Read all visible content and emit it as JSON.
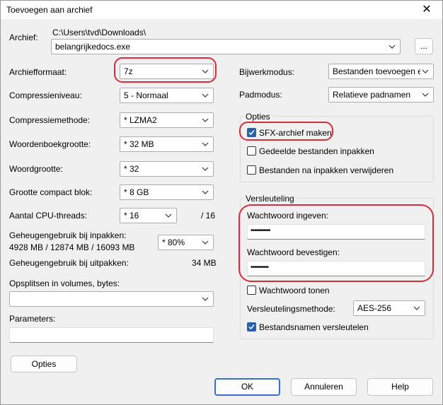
{
  "window": {
    "title": "Toevoegen aan archief",
    "close_glyph": "✕"
  },
  "archive": {
    "label": "Archief:",
    "path": "C:\\Users\\tvd\\Downloads\\",
    "filename": "belangrijkedocs.exe",
    "browse_label": "..."
  },
  "left": {
    "format": {
      "label": "Archiefformaat:",
      "value": "7z"
    },
    "level": {
      "label": "Compressieniveau:",
      "value": "5 - Normaal"
    },
    "method": {
      "label": "Compressiemethode:",
      "value": "*  LZMA2"
    },
    "dict": {
      "label": "Woordenboekgrootte:",
      "value": "*  32 MB"
    },
    "word": {
      "label": "Woordgrootte:",
      "value": "*  32"
    },
    "solid": {
      "label": "Grootte compact blok:",
      "value": "*  8 GB"
    },
    "threads": {
      "label": "Aantal CPU-threads:",
      "value": "*  16",
      "max": "/ 16"
    },
    "mem_pack": {
      "label": "Geheugengebruik bij inpakken:",
      "value": "4928 MB / 12874 MB / 16093 MB",
      "percent": "*  80%"
    },
    "mem_unpack": {
      "label": "Geheugengebruik bij uitpakken:",
      "value": "34 MB"
    },
    "split": {
      "label": "Opsplitsen in volumes, bytes:",
      "value": ""
    },
    "params": {
      "label": "Parameters:",
      "value": ""
    },
    "options_button": "Opties"
  },
  "right": {
    "update": {
      "label": "Bijwerkmodus:",
      "value": "Bestanden toevoegen en v"
    },
    "pathmode": {
      "label": "Padmodus:",
      "value": "Relatieve padnamen"
    },
    "options": {
      "title": "Opties",
      "sfx": {
        "label": "SFX-archief maken",
        "checked": true
      },
      "shared": {
        "label": "Gedeelde bestanden inpakken",
        "checked": false
      },
      "delete": {
        "label": "Bestanden na inpakken verwijderen",
        "checked": false
      }
    },
    "encryption": {
      "title": "Versleuteling",
      "pw_label": "Wachtwoord ingeven:",
      "pw_value": "•••••••••••",
      "confirm_label": "Wachtwoord bevestigen:",
      "confirm_value": "••••••••••",
      "show": {
        "label": "Wachtwoord tonen",
        "checked": false
      },
      "method": {
        "label": "Versleutelingsmethode:",
        "value": "AES-256"
      },
      "encnames": {
        "label": "Bestandsnamen versleutelen",
        "checked": true
      }
    }
  },
  "buttons": {
    "ok": "OK",
    "cancel": "Annuleren",
    "help": "Help"
  },
  "colors": {
    "accent": "#2b5fae",
    "highlight": "#d62c3b",
    "ok_border": "#3a6fc2"
  },
  "icons": {
    "dropdown": "chevron-down-icon",
    "checkmark": "checkmark-icon",
    "close": "close-icon"
  }
}
